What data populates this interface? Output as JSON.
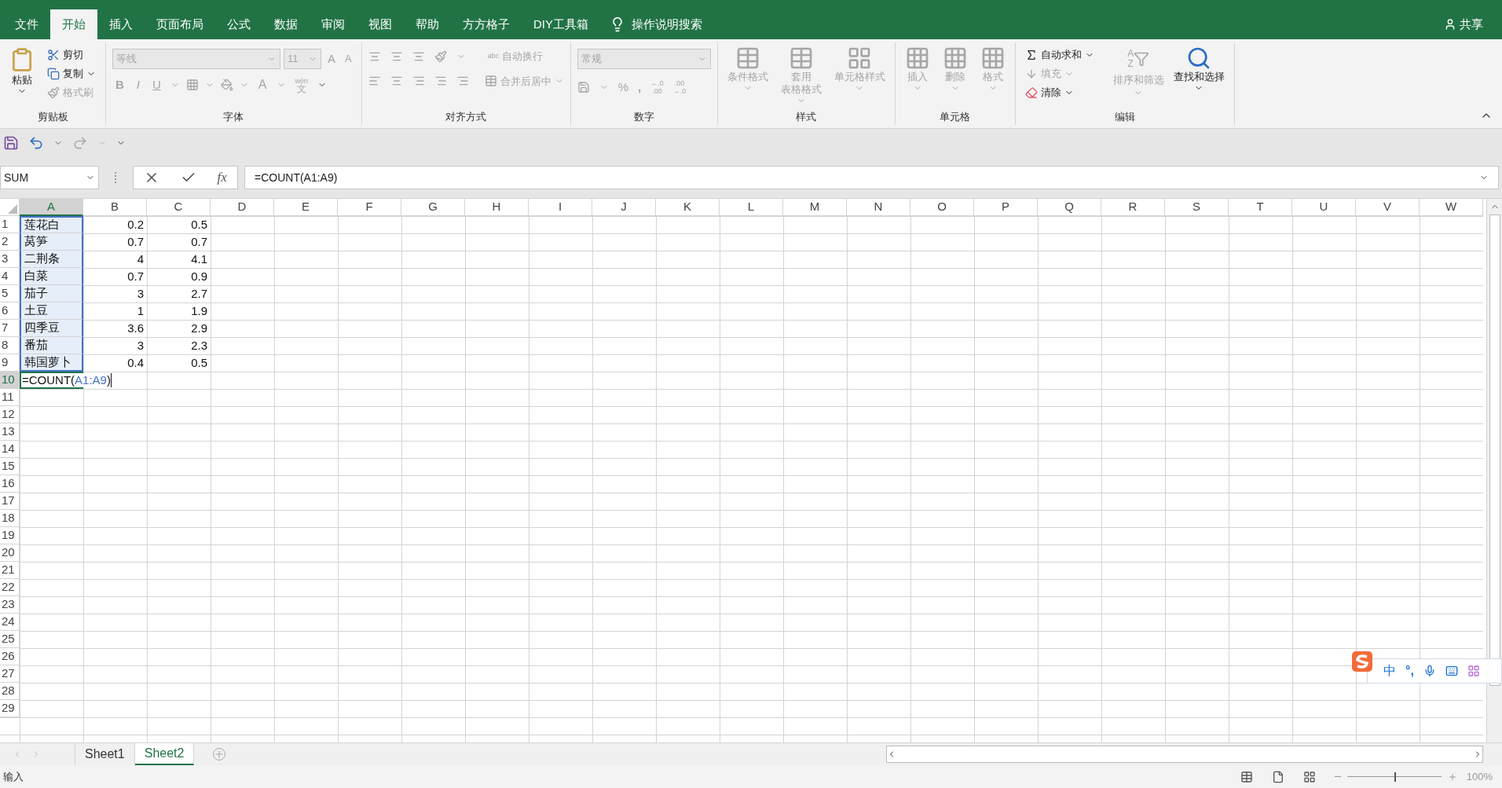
{
  "ribbon_tabs": [
    {
      "label": "文件",
      "selected": false
    },
    {
      "label": "开始",
      "selected": true
    },
    {
      "label": "插入",
      "selected": false
    },
    {
      "label": "页面布局",
      "selected": false
    },
    {
      "label": "公式",
      "selected": false
    },
    {
      "label": "数据",
      "selected": false
    },
    {
      "label": "审阅",
      "selected": false
    },
    {
      "label": "视图",
      "selected": false
    },
    {
      "label": "帮助",
      "selected": false
    },
    {
      "label": "方方格子",
      "selected": false
    },
    {
      "label": "DIY工具箱",
      "selected": false
    }
  ],
  "tell_me": "操作说明搜索",
  "share": "共享",
  "clipboard": {
    "label": "剪贴板",
    "paste": {
      "label": "粘贴",
      "disabled": false
    },
    "cut": {
      "label": "剪切",
      "disabled": false
    },
    "copy": {
      "label": "复制",
      "disabled": false
    },
    "format_painter": {
      "label": "格式刷",
      "disabled": true
    }
  },
  "font": {
    "label": "字体",
    "disabled": true,
    "font_name": "等线",
    "font_size": "11",
    "grow": "A",
    "shrink": "A",
    "bold": "B",
    "italic": "I",
    "underline": "U",
    "font_color": "A",
    "phonetic_top": "wén",
    "phonetic_bottom": "文"
  },
  "alignment": {
    "label": "对齐方式",
    "disabled": true,
    "wrap_text": "自动换行",
    "merge": "合并后居中",
    "wrap_icon_text": "abc"
  },
  "number": {
    "label": "数字",
    "disabled": true,
    "format": "常规",
    "percent": "%",
    "comma": ",",
    "increase_decimal": [
      "←.0",
      ".00"
    ],
    "decrease_decimal": [
      ".00",
      "→.0"
    ]
  },
  "styles": {
    "label": "样式",
    "disabled": true,
    "conditional": "条件格式",
    "table_format": [
      "套用",
      "表格格式"
    ],
    "cell_styles": "单元格样式"
  },
  "cells": {
    "label": "单元格",
    "disabled": true,
    "insert": "插入",
    "delete": "删除",
    "format": "格式"
  },
  "editing": {
    "label": "编辑",
    "autosum": {
      "label": "自动求和",
      "disabled": false
    },
    "fill": {
      "label": "填充",
      "disabled": true
    },
    "clear": {
      "label": "清除",
      "disabled": false
    },
    "sort_filter": {
      "label": "排序和筛选",
      "disabled": true,
      "letters": [
        "A",
        "Z"
      ]
    },
    "find_select": {
      "label": "查找和选择",
      "disabled": false
    }
  },
  "formula_bar": {
    "name_box": "SUM",
    "fx": "fx",
    "formula": "=COUNT(A1:A9)"
  },
  "columns": [
    {
      "label": "A",
      "selected": true
    },
    {
      "label": "B",
      "selected": false
    },
    {
      "label": "C",
      "selected": false
    },
    {
      "label": "D",
      "selected": false
    },
    {
      "label": "E",
      "selected": false
    },
    {
      "label": "F",
      "selected": false
    },
    {
      "label": "G",
      "selected": false
    },
    {
      "label": "H",
      "selected": false
    },
    {
      "label": "I",
      "selected": false
    },
    {
      "label": "J",
      "selected": false
    },
    {
      "label": "K",
      "selected": false
    },
    {
      "label": "L",
      "selected": false
    },
    {
      "label": "M",
      "selected": false
    },
    {
      "label": "N",
      "selected": false
    },
    {
      "label": "O",
      "selected": false
    },
    {
      "label": "P",
      "selected": false
    },
    {
      "label": "Q",
      "selected": false
    },
    {
      "label": "R",
      "selected": false
    },
    {
      "label": "S",
      "selected": false
    },
    {
      "label": "T",
      "selected": false
    },
    {
      "label": "U",
      "selected": false
    },
    {
      "label": "V",
      "selected": false
    },
    {
      "label": "W",
      "selected": false
    }
  ],
  "rows": [
    {
      "header": "1",
      "selected": false,
      "referenced": true,
      "cells": [
        "莲花白",
        "0.2",
        "0.5"
      ]
    },
    {
      "header": "2",
      "selected": false,
      "referenced": true,
      "cells": [
        "莴笋",
        "0.7",
        "0.7"
      ]
    },
    {
      "header": "3",
      "selected": false,
      "referenced": true,
      "cells": [
        "二荆条",
        "4",
        "4.1"
      ]
    },
    {
      "header": "4",
      "selected": false,
      "referenced": true,
      "cells": [
        "白菜",
        "0.7",
        "0.9"
      ]
    },
    {
      "header": "5",
      "selected": false,
      "referenced": true,
      "cells": [
        "茄子",
        "3",
        "2.7"
      ]
    },
    {
      "header": "6",
      "selected": false,
      "referenced": true,
      "cells": [
        "土豆",
        "1",
        "1.9"
      ]
    },
    {
      "header": "7",
      "selected": false,
      "referenced": true,
      "cells": [
        "四季豆",
        "3.6",
        "2.9"
      ]
    },
    {
      "header": "8",
      "selected": false,
      "referenced": true,
      "cells": [
        "番茄",
        "3",
        "2.3"
      ]
    },
    {
      "header": "9",
      "selected": false,
      "referenced": true,
      "cells": [
        "韩国萝卜",
        "0.4",
        "0.5"
      ]
    },
    {
      "header": "10",
      "selected": true,
      "referenced": false,
      "editing": {
        "prefix": "=COUNT(",
        "reference": "A1:A9",
        "suffix": ")"
      }
    },
    {
      "header": "11",
      "selected": false,
      "referenced": false
    },
    {
      "header": "12",
      "selected": false,
      "referenced": false
    },
    {
      "header": "13",
      "selected": false,
      "referenced": false
    },
    {
      "header": "14",
      "selected": false,
      "referenced": false
    },
    {
      "header": "15",
      "selected": false,
      "referenced": false
    },
    {
      "header": "16",
      "selected": false,
      "referenced": false
    },
    {
      "header": "17",
      "selected": false,
      "referenced": false
    },
    {
      "header": "18",
      "selected": false,
      "referenced": false
    },
    {
      "header": "19",
      "selected": false,
      "referenced": false
    },
    {
      "header": "20",
      "selected": false,
      "referenced": false
    },
    {
      "header": "21",
      "selected": false,
      "referenced": false
    },
    {
      "header": "22",
      "selected": false,
      "referenced": false
    },
    {
      "header": "23",
      "selected": false,
      "referenced": false
    },
    {
      "header": "24",
      "selected": false,
      "referenced": false
    },
    {
      "header": "25",
      "selected": false,
      "referenced": false
    },
    {
      "header": "26",
      "selected": false,
      "referenced": false
    },
    {
      "header": "27",
      "selected": false,
      "referenced": false
    },
    {
      "header": "28",
      "selected": false,
      "referenced": false
    },
    {
      "header": "29",
      "selected": false,
      "referenced": false
    }
  ],
  "sheet_tabs": [
    {
      "label": "Sheet1",
      "selected": false
    },
    {
      "label": "Sheet2",
      "selected": true
    }
  ],
  "status_bar": {
    "mode": "输入",
    "zoom": "100%",
    "zoom_level": {
      "level": 0.5
    }
  },
  "ime_toolbar": {
    "mode": "中",
    "punctuation": "°,"
  }
}
